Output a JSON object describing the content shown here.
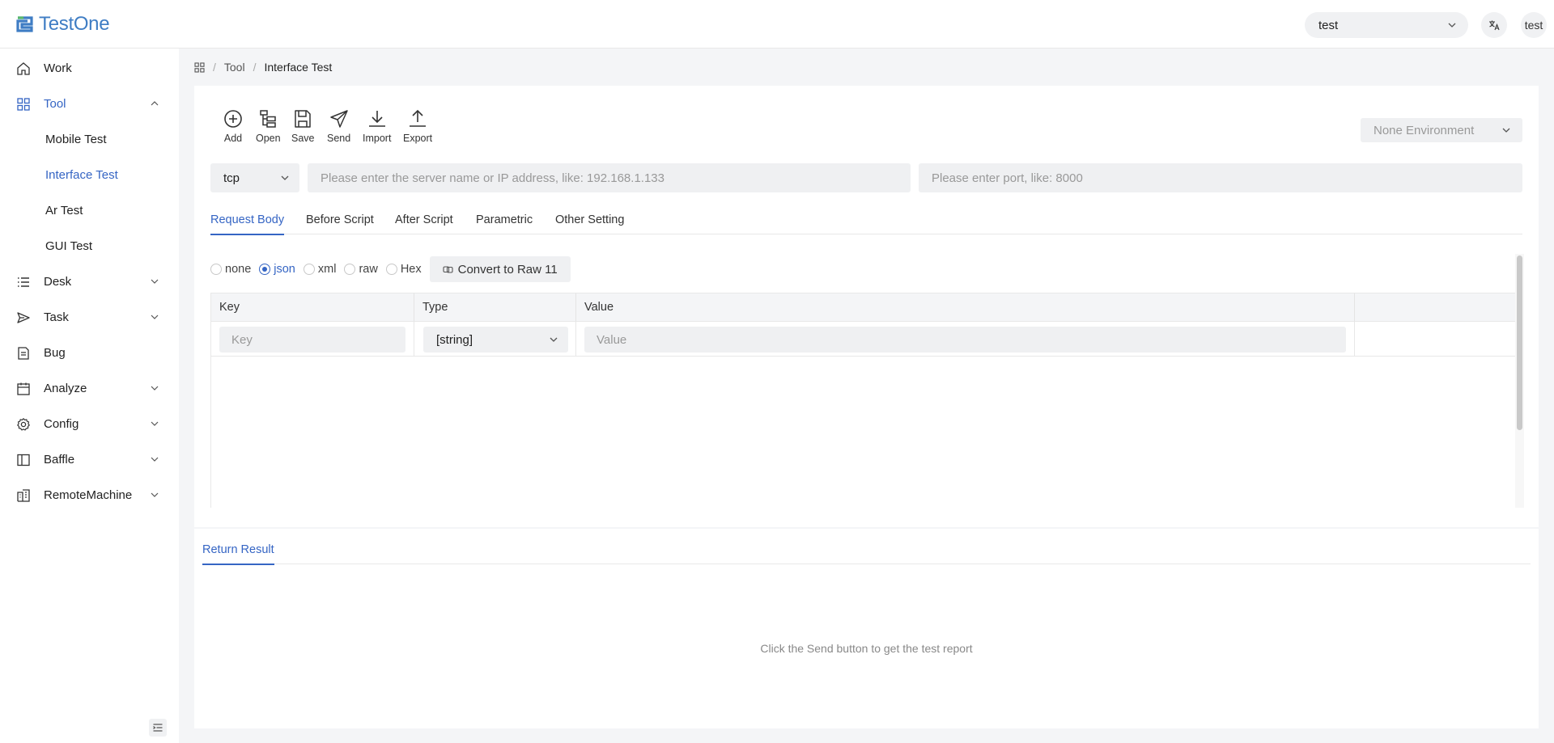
{
  "header": {
    "logo_text": "TestOne",
    "project_select": "test",
    "translate_icon": "translate-icon",
    "user": "test"
  },
  "sidebar": {
    "items": [
      {
        "label": "Work",
        "icon": "home-icon"
      },
      {
        "label": "Tool",
        "icon": "grid-icon"
      },
      {
        "label": "Desk",
        "icon": "list-icon"
      },
      {
        "label": "Task",
        "icon": "send-icon"
      },
      {
        "label": "Bug",
        "icon": "document-icon"
      },
      {
        "label": "Analyze",
        "icon": "calendar-icon"
      },
      {
        "label": "Config",
        "icon": "gear-icon"
      },
      {
        "label": "Baffle",
        "icon": "layout-icon"
      },
      {
        "label": "RemoteMachine",
        "icon": "building-icon"
      }
    ],
    "tool_children": [
      "Mobile Test",
      "Interface Test",
      "Ar Test",
      "GUI Test"
    ],
    "active_child": "Interface Test"
  },
  "breadcrumb": {
    "home_icon": "apps-icon",
    "items": [
      "Tool",
      "Interface Test"
    ]
  },
  "toolbar": {
    "tools": [
      {
        "label": "Add",
        "icon": "plus-circle-icon"
      },
      {
        "label": "Open",
        "icon": "tree-icon"
      },
      {
        "label": "Save",
        "icon": "save-icon"
      },
      {
        "label": "Send",
        "icon": "send-icon"
      },
      {
        "label": "Import",
        "icon": "download-icon"
      },
      {
        "label": "Export",
        "icon": "upload-icon"
      }
    ],
    "environment": "None Environment"
  },
  "request": {
    "protocol": "tcp",
    "server_placeholder": "Please enter the server name or IP address, like: 192.168.1.133",
    "port_placeholder": "Please enter port, like: 8000"
  },
  "tabs": [
    "Request Body",
    "Before Script",
    "After Script",
    "Parametric",
    "Other Setting"
  ],
  "active_tab": "Request Body",
  "body_types": [
    "none",
    "json",
    "xml",
    "raw",
    "Hex"
  ],
  "selected_body_type": "json",
  "convert_button": "Convert to Raw 11",
  "table": {
    "headers": [
      "Key",
      "Type",
      "Value",
      ""
    ],
    "row": {
      "key_placeholder": "Key",
      "type": "[string]",
      "value_placeholder": "Value"
    }
  },
  "result": {
    "tab": "Return Result",
    "empty_message": "Click the Send button to get the test report"
  },
  "colors": {
    "accent": "#3565c4",
    "brand": "#3f7dc4"
  }
}
